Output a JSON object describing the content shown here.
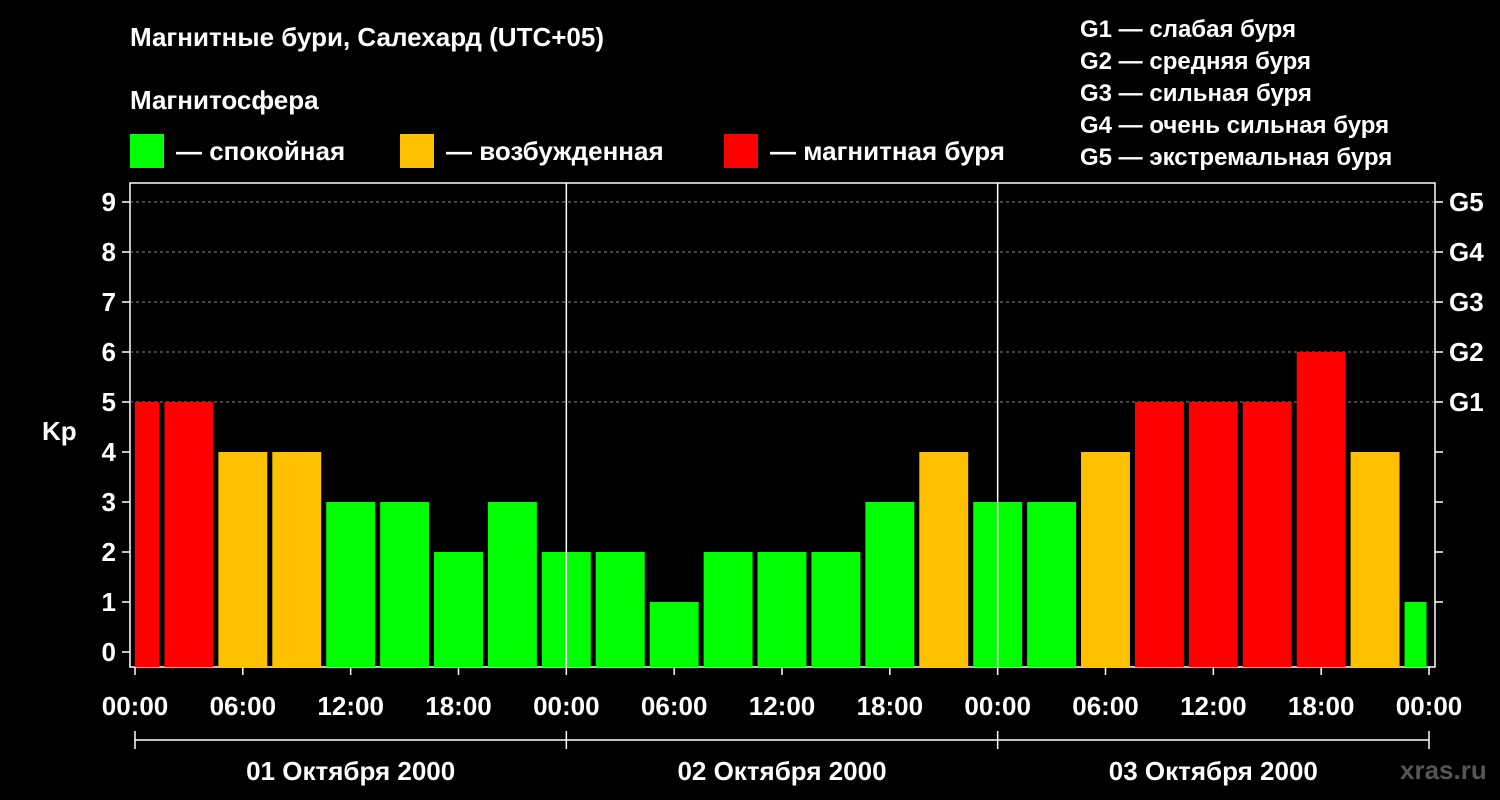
{
  "title": "Магнитные бури, Салехард (UTC+05)",
  "subtitle": "Магнитосфера",
  "legend": [
    {
      "label": "— спокойная",
      "color": "#00ff00"
    },
    {
      "label": "— возбужденная",
      "color": "#ffc000"
    },
    {
      "label": "— магнитная буря",
      "color": "#ff0000"
    }
  ],
  "g_legend": [
    "G1 — слабая буря",
    "G2 — средняя буря",
    "G3 — сильная буря",
    "G4 — очень сильная буря",
    "G5 — экстремальная буря"
  ],
  "watermark": "xras.ru",
  "chart_data": {
    "type": "bar",
    "ylabel": "Kp",
    "ylim": [
      0,
      9
    ],
    "yticks": [
      "0",
      "1",
      "2",
      "3",
      "4",
      "5",
      "6",
      "7",
      "8",
      "9"
    ],
    "right_ticks": [
      {
        "value": 5,
        "label": "G1"
      },
      {
        "value": 6,
        "label": "G2"
      },
      {
        "value": 7,
        "label": "G3"
      },
      {
        "value": 8,
        "label": "G4"
      },
      {
        "value": 9,
        "label": "G5"
      }
    ],
    "xticks": [
      "00:00",
      "06:00",
      "12:00",
      "18:00",
      "00:00",
      "06:00",
      "12:00",
      "18:00",
      "00:00",
      "06:00",
      "12:00",
      "18:00",
      "00:00"
    ],
    "days": [
      "01 Октября 2000",
      "02 Октября 2000",
      "03 Октября 2000"
    ],
    "grid": true,
    "colors": {
      "quiet": "#00ff00",
      "active": "#ffc000",
      "storm": "#ff0000"
    },
    "values": [
      5,
      5,
      4,
      4,
      3,
      3,
      2,
      3,
      2,
      2,
      1,
      2,
      2,
      2,
      3,
      4,
      3,
      3,
      4,
      5,
      5,
      5,
      6,
      4,
      1
    ]
  }
}
